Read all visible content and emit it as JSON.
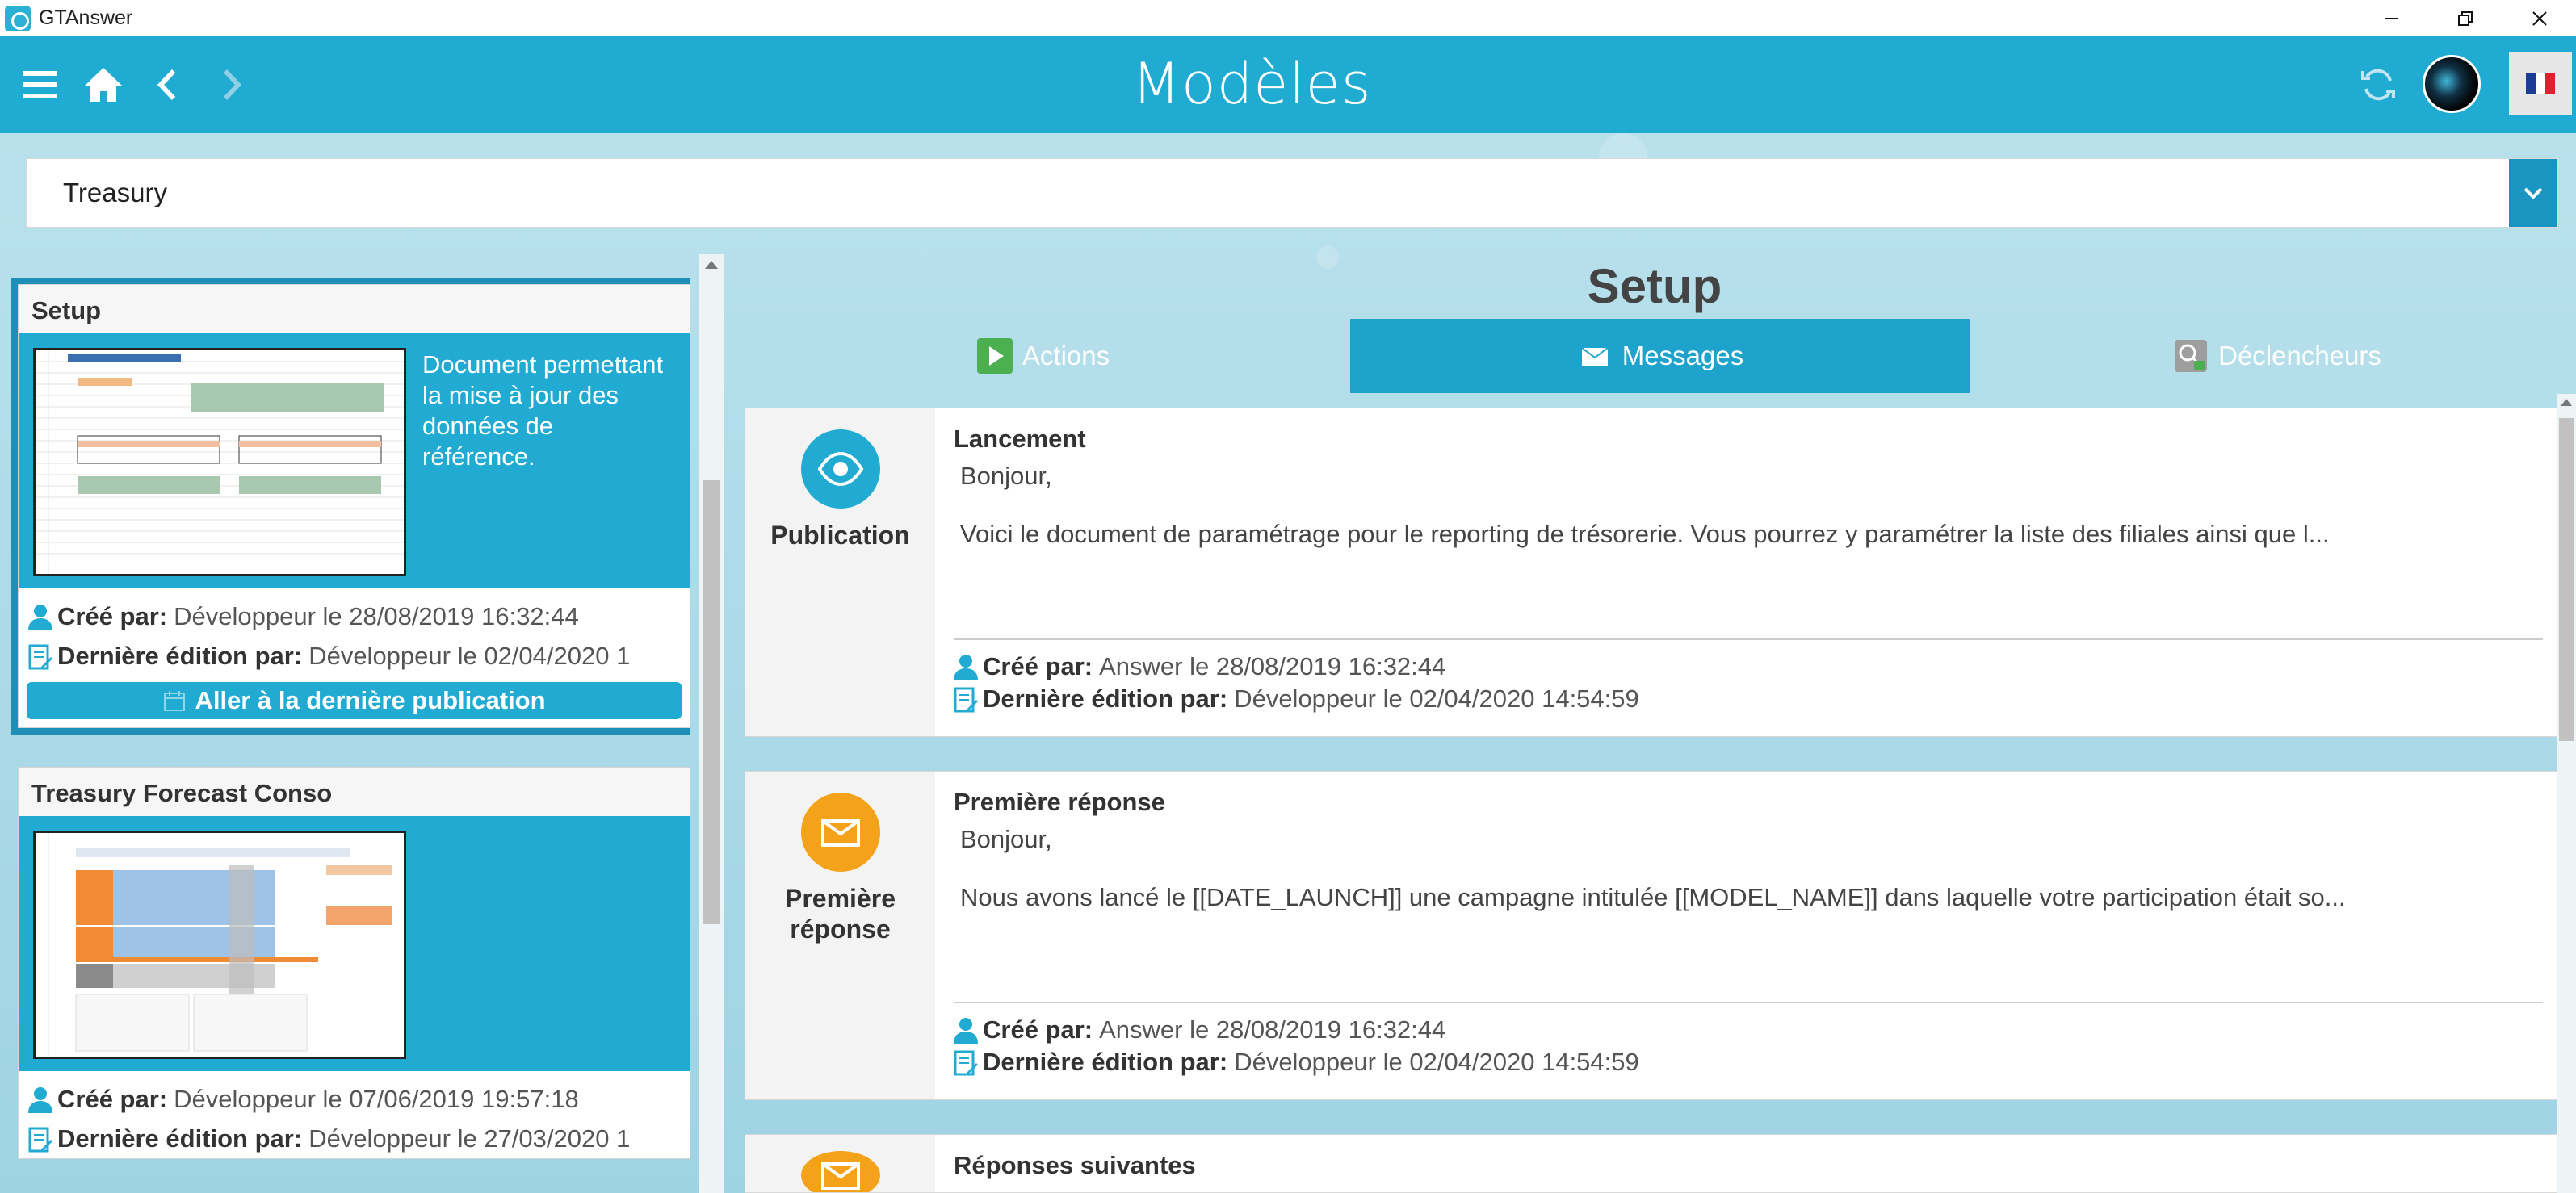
{
  "window": {
    "app_title": "GTAnswer"
  },
  "header": {
    "page_title": "Modèles"
  },
  "model_select": {
    "value": "Treasury"
  },
  "colors": {
    "accent": "#20abd3",
    "accent_dark": "#1a95c2",
    "orange": "#f5a21b",
    "green": "#4caf50"
  },
  "models": [
    {
      "title": "Setup",
      "description": "Document permettant la mise à jour des données de référence.",
      "created_label": "Créé par:",
      "created_value": "Développeur le 28/08/2019 16:32:44",
      "edited_label": "Dernière édition par:",
      "edited_value": "Développeur le 02/04/2020 1",
      "goto_label": "Aller à la dernière publication"
    },
    {
      "title": "Treasury Forecast Conso",
      "description": "",
      "created_label": "Créé par:",
      "created_value": "Développeur le 07/06/2019 19:57:18",
      "edited_label": "Dernière édition par:",
      "edited_value": "Développeur le 27/03/2020 1"
    }
  ],
  "detail": {
    "title": "Setup",
    "tabs": [
      {
        "label": "Actions",
        "icon": "play-icon"
      },
      {
        "label": "Messages",
        "icon": "envelope-icon"
      },
      {
        "label": "Déclencheurs",
        "icon": "trigger-icon"
      }
    ],
    "messages": [
      {
        "kind": "Publication",
        "icon": "eye-icon",
        "title": "Lancement",
        "greeting": "Bonjour,",
        "text": "Voici le document de paramétrage pour le reporting de trésorerie. Vous pourrez y paramétrer la liste des filiales ainsi que l...",
        "created_label": "Créé par:",
        "created_value": "Answer le 28/08/2019 16:32:44",
        "edited_label": "Dernière édition par:",
        "edited_value": "Développeur le 02/04/2020 14:54:59"
      },
      {
        "kind_line1": "Première",
        "kind_line2": "réponse",
        "icon": "envelope-reply-icon",
        "title": "Première réponse",
        "greeting": "Bonjour,",
        "text": "Nous avons lancé le [[DATE_LAUNCH]] une campagne intitulée [[MODEL_NAME]] dans laquelle votre participation était so...",
        "created_label": "Créé par:",
        "created_value": "Answer le 28/08/2019 16:32:44",
        "edited_label": "Dernière édition par:",
        "edited_value": "Développeur le 02/04/2020 14:54:59"
      },
      {
        "icon": "envelope-reply-icon",
        "title": "Réponses suivantes"
      }
    ]
  }
}
